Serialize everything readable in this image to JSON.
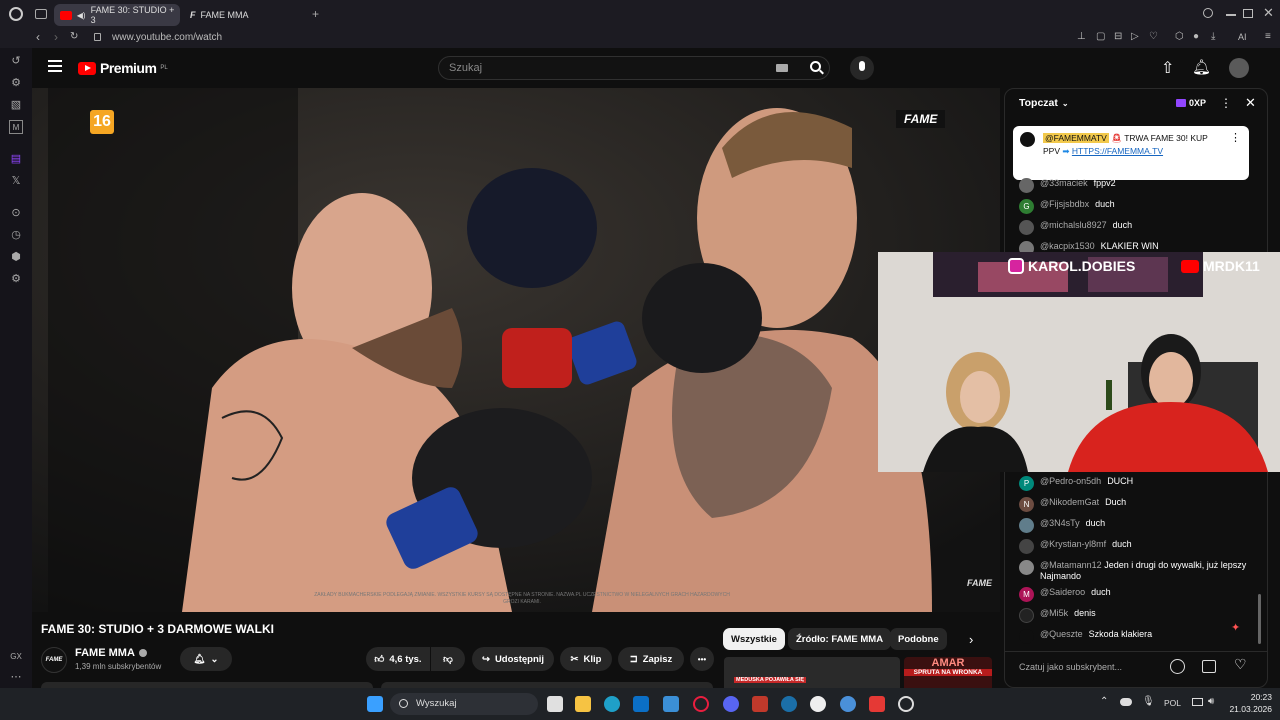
{
  "browser": {
    "tabs": [
      {
        "label": "FAME 30: STUDIO + 3",
        "active": true
      },
      {
        "label": "FAME MMA",
        "active": false
      }
    ],
    "new_tab": "+",
    "url": "www.youtube.com/watch",
    "ai_label": "AI"
  },
  "youtube": {
    "logo": "Premium",
    "logo_badge": "PL",
    "search_placeholder": "Szukaj"
  },
  "video": {
    "age_badge": "16",
    "watermark": "FAME",
    "watermark_small": "FAME",
    "disclaimer": "ZAKŁADY BUKMACHERSKIE PODLEGAJĄ ZMIANIE. WSZYSTKIE KURSY SĄ DOSTĘPNE NA STRONIE. NAZWA.PL UCZESTNICTWO W NIELEGALNYCH GRACH HAZARDOWYCH GROZI KARAMI.",
    "title": "FAME 30: STUDIO + 3 DARMOWE WALKI",
    "channel": "FAME MMA",
    "channel_logo": "FAME",
    "subscribers": "1,39 mln subskrybentów",
    "likes": "4,6 tys.",
    "share": "Udostępnij",
    "clip": "Klip",
    "save": "Zapisz",
    "more": "•••"
  },
  "chips": [
    "Wszystkie",
    "Źródło: FAME MMA",
    "Podobne"
  ],
  "related": [
    {
      "label": "MEDUSKA POJAWIŁA SIĘ"
    },
    {
      "label": "AMAR",
      "sub": "SPRUTA NA WRONKA"
    }
  ],
  "chat": {
    "title": "Topczat",
    "xp": "0XP",
    "pinned": {
      "author": "@FAMEMMATV",
      "text": "TRWA FAME 30! KUP PPV",
      "link": "HTTPS://FAMEMMA.TV"
    },
    "messages_top": [
      {
        "author": "@33maciek",
        "text": "fppv2",
        "color": "#666"
      },
      {
        "author": "@Fijsjsbdbx",
        "text": "duch",
        "color": "#2e7d32",
        "initial": "G"
      },
      {
        "author": "@michalslu8927",
        "text": "duch",
        "color": "#555"
      },
      {
        "author": "@kacpix1530",
        "text": "KLAKIER WIN",
        "color": "#777"
      }
    ],
    "messages_bottom": [
      {
        "author": "@Pedro-on5dh",
        "text": "DUCH",
        "color": "#00897b",
        "initial": "P"
      },
      {
        "author": "@NikodemGat",
        "text": "Duch",
        "color": "#6d4c41",
        "initial": "N"
      },
      {
        "author": "@3N4sTy",
        "text": "duch",
        "color": "#607d8b"
      },
      {
        "author": "@Krystian-yl8mf",
        "text": "duch",
        "color": "#444"
      },
      {
        "author": "@Matamann12",
        "text": "Jeden i drugi do wywalki, już lepszy Najmando",
        "color": "#888"
      },
      {
        "author": "@Saideroo",
        "text": "duch",
        "color": "#ad1457",
        "initial": "M"
      },
      {
        "author": "@Mi5k",
        "text": "denis",
        "color": "#222"
      },
      {
        "author": "@Queszte",
        "text": "Szkoda klakiera",
        "color": "#0f0f0f"
      }
    ],
    "input_placeholder": "Czatuj jako subskrybent..."
  },
  "webcam": {
    "instagram": "KAROL.DOBIES",
    "youtube": "MRDK11"
  },
  "taskbar": {
    "search": "Wyszukaj",
    "lang": "POL",
    "time": "20:23",
    "date": "21.03.2026"
  },
  "sidebar": {
    "gx": "GX"
  },
  "colors": {
    "yt_red": "#ff0000",
    "chat_link": "#3ea6ff",
    "pinned_bg": "#ffffff"
  }
}
